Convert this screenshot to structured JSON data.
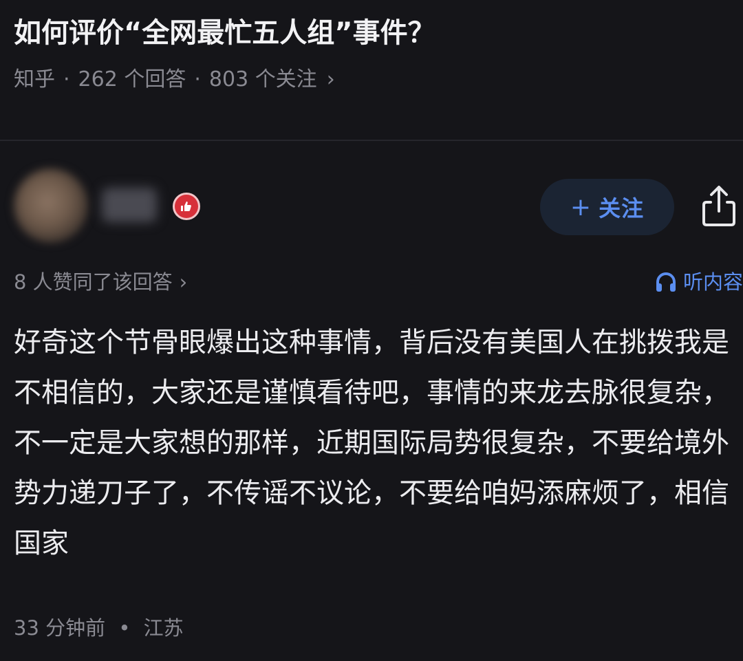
{
  "question": {
    "title": "如何评价“全网最忙五人组”事件？",
    "source": "知乎",
    "answers_count": "262 个回答",
    "followers_count": "803 个关注",
    "separator": "·",
    "chevron": "›"
  },
  "author": {
    "avatar_icon": "blurred-avatar",
    "badge_icon": "thumb-up-icon",
    "follow_label": "关注",
    "follow_plus": "+",
    "share_icon": "share-icon"
  },
  "answer_meta": {
    "likes_text": "8 人赞同了该回答",
    "chevron": "›",
    "listen_label": "听内容",
    "listen_icon": "headphones-icon"
  },
  "answer": {
    "content": "好奇这个节骨眼爆出这种事情，背后没有美国人在挑拨我是不相信的，大家还是谨慎看待吧，事情的来龙去脉很复杂，不一定是大家想的那样，近期国际局势很复杂，不要给境外势力递刀子了，不传谣不议论，不要给咱妈添麻烦了，相信国家"
  },
  "footer": {
    "time": "33 分钟前",
    "separator": "•",
    "location": "江苏"
  },
  "colors": {
    "background": "#151519",
    "accent": "#5b8ef0",
    "muted_text": "#8a8a92",
    "badge_red": "#d7303a"
  }
}
